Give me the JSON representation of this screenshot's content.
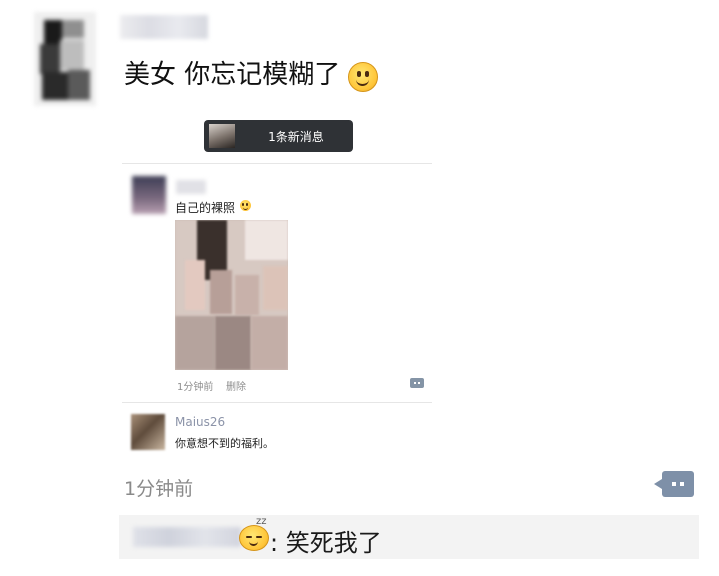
{
  "post": {
    "text": "美女 你忘记模糊了",
    "emoji": "smile-emoji"
  },
  "screenshot": {
    "notification": "1条新消息",
    "inner_post_text": "自己的裸照",
    "inner_post_emoji": "smile-emoji",
    "time": "1分钟前",
    "delete": "删除",
    "comment": {
      "user": "Maius26",
      "text": "你意想不到的福利。"
    }
  },
  "footer": {
    "time": "1分钟前",
    "comment_icon": "comment-icon"
  },
  "reply": {
    "separator": ":",
    "text": "笑死我了",
    "emoji": "sleepy-emoji"
  }
}
